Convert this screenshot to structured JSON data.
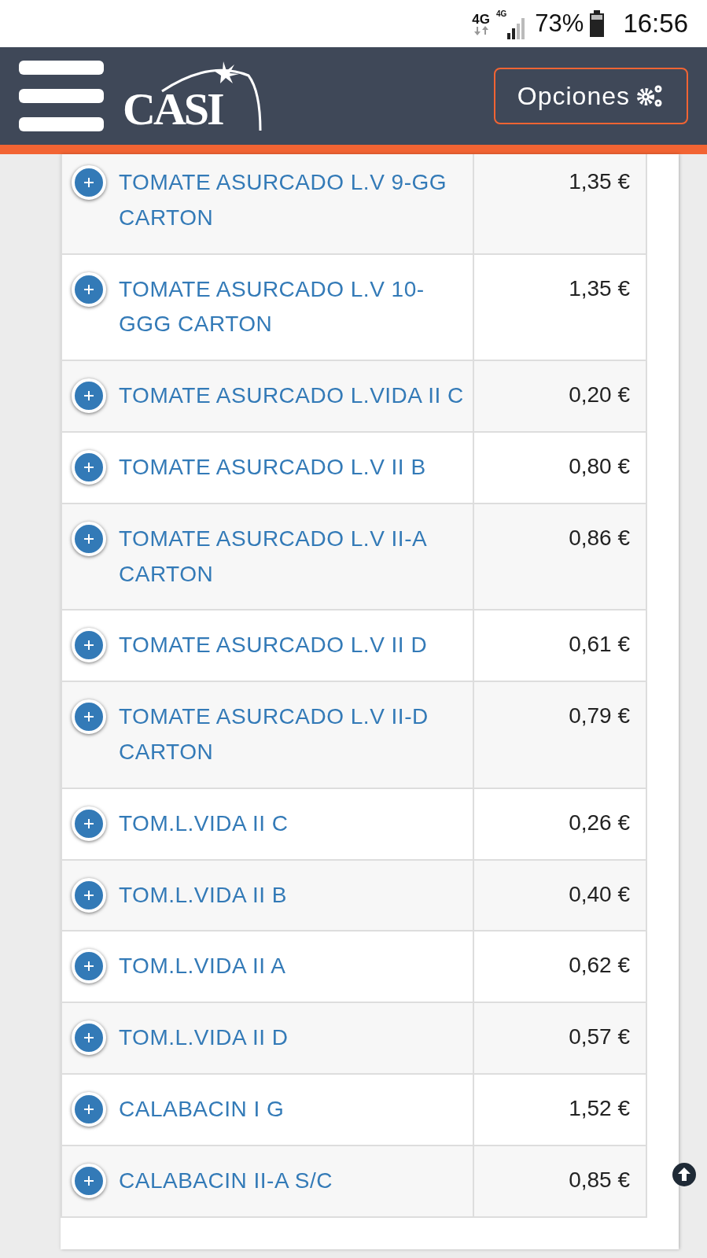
{
  "status_bar": {
    "network": "4G",
    "network_small": "4G",
    "battery": "73%",
    "time": "16:56"
  },
  "header": {
    "logo": "CASI",
    "options_button": "Opciones"
  },
  "products": [
    {
      "name": "TOMATE ASURCADO L.V 9-GG CARTON",
      "price": "1,35 €"
    },
    {
      "name": "TOMATE ASURCADO L.V 10-GGG CARTON",
      "price": "1,35 €"
    },
    {
      "name": "TOMATE ASURCADO L.VIDA II C",
      "price": "0,20 €"
    },
    {
      "name": "TOMATE ASURCADO L.V II B",
      "price": "0,80 €"
    },
    {
      "name": "TOMATE ASURCADO L.V II-A CARTON",
      "price": "0,86 €"
    },
    {
      "name": "TOMATE ASURCADO L.V II D",
      "price": "0,61 €"
    },
    {
      "name": "TOMATE ASURCADO L.V II-D CARTON",
      "price": "0,79 €"
    },
    {
      "name": "TOM.L.VIDA II C",
      "price": "0,26 €"
    },
    {
      "name": "TOM.L.VIDA II B",
      "price": "0,40 €"
    },
    {
      "name": "TOM.L.VIDA II A",
      "price": "0,62 €"
    },
    {
      "name": "TOM.L.VIDA II D",
      "price": "0,57 €"
    },
    {
      "name": "CALABACIN I G",
      "price": "1,52 €"
    },
    {
      "name": "CALABACIN II-A S/C",
      "price": "0,85 €"
    }
  ]
}
